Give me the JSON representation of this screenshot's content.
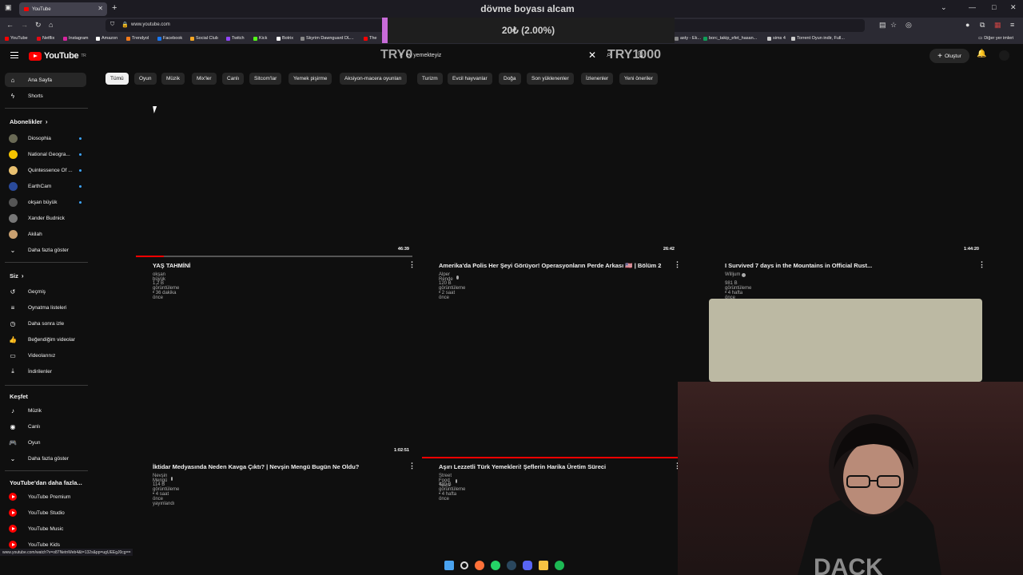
{
  "browser": {
    "tab_title": "YouTube",
    "url": "www.youtube.com",
    "status_url": "www.youtube.com/watch?v=o87NetnWeb4&t=132s&pp=ugUEEgJ0cg==",
    "bookmarks": [
      {
        "label": "YouTube",
        "color": "#ff0000"
      },
      {
        "label": "Netflix",
        "color": "#e50914"
      },
      {
        "label": "Instagram",
        "color": "#d6249f"
      },
      {
        "label": "Amazon",
        "color": "#ffffff"
      },
      {
        "label": "Trendyol",
        "color": "#f27a1a"
      },
      {
        "label": "Facebook",
        "color": "#1877f2"
      },
      {
        "label": "Social Club",
        "color": "#f5a623"
      },
      {
        "label": "Twitch",
        "color": "#9146ff"
      },
      {
        "label": "Kick",
        "color": "#53fc18"
      },
      {
        "label": "Botrix",
        "color": "#ffffff"
      },
      {
        "label": "Skyrim Dawnguard DL...",
        "color": "#888888"
      },
      {
        "label": "The",
        "color": "#ff0000"
      }
    ],
    "bookmarks_right": [
      {
        "label": "asty - Ek...",
        "color": "#888888"
      },
      {
        "label": "borc_takip_efet_hasan...",
        "color": "#0f9d58"
      },
      {
        "label": "sims 4",
        "color": "#cccccc"
      },
      {
        "label": "Torrent Oyun indir, Full...",
        "color": "#cccccc"
      }
    ],
    "other_bookmarks": "Diğer yer imleri"
  },
  "overlay": {
    "title": "dövme boyası alcam",
    "progress_text": "20₺ (2.00%)",
    "progress_fraction": 0.02,
    "left_label": "TRY0",
    "right_label": "TRY1000",
    "bar_color": "#c86bd8"
  },
  "header": {
    "logo_text": "YouTube",
    "logo_suffix": "TR",
    "search_value": "ev yemekteyiz",
    "search_prefix": "e",
    "create_label": "Oluştur"
  },
  "chips": [
    "Tümü",
    "Oyun",
    "Müzik",
    "Mix'ler",
    "Canlı",
    "Sitcom'lar",
    "Yemek pişirme",
    "Aksiyon-macera oyunları",
    "Turizm",
    "Evcil hayvanlar",
    "Doğa",
    "Son yüklenenler",
    "İzlenenler",
    "Yeni öneriler"
  ],
  "sidebar": {
    "main": [
      {
        "label": "Ana Sayfa",
        "icon": "home-icon",
        "glyph": "⌂"
      },
      {
        "label": "Shorts",
        "icon": "shorts-icon",
        "glyph": "ϟ"
      }
    ],
    "subs_heading": "Abonelikler",
    "subs": [
      {
        "label": "Diosophia",
        "color": "#6a6a55",
        "dot": true
      },
      {
        "label": "National Geogra...",
        "color": "#f5c400",
        "dot": true
      },
      {
        "label": "Quintessence Of ...",
        "color": "#e8c070",
        "dot": true
      },
      {
        "label": "EarthCam",
        "color": "#2a4a9a",
        "dot": true
      },
      {
        "label": "okşan büyük",
        "color": "#555555",
        "dot": true
      },
      {
        "label": "Xander Budnick",
        "color": "#777777",
        "dot": false
      },
      {
        "label": "Akilah",
        "color": "#c8a070",
        "dot": false
      }
    ],
    "subs_more": "Daha fazla göster",
    "you_heading": "Siz",
    "you": [
      {
        "label": "Geçmiş",
        "icon": "history-icon",
        "glyph": "↺"
      },
      {
        "label": "Oynatma listeleri",
        "icon": "playlists-icon",
        "glyph": "≡"
      },
      {
        "label": "Daha sonra izle",
        "icon": "watch-later-icon",
        "glyph": "◷"
      },
      {
        "label": "Beğendiğim videolar",
        "icon": "like-icon",
        "glyph": "👍"
      },
      {
        "label": "Videolarınız",
        "icon": "your-videos-icon",
        "glyph": "▭"
      },
      {
        "label": "İndirilenler",
        "icon": "download-icon",
        "glyph": "⤓"
      }
    ],
    "explore_heading": "Keşfet",
    "explore": [
      {
        "label": "Müzik",
        "icon": "music-icon",
        "glyph": "♪"
      },
      {
        "label": "Canlı",
        "icon": "live-icon",
        "glyph": "◉"
      },
      {
        "label": "Oyun",
        "icon": "gaming-icon",
        "glyph": "🎮"
      }
    ],
    "explore_more": "Daha fazla göster",
    "more_heading": "YouTube'dan daha fazla...",
    "more": [
      "YouTube Premium",
      "YouTube Studio",
      "YouTube Music",
      "YouTube Kids"
    ]
  },
  "videos": [
    {
      "title": "YAŞ TAHMİNİ",
      "channel": "okşan büyük",
      "verified": false,
      "meta": "1,2 B görüntüleme • 36 dakika önce",
      "duration": "46:39",
      "watched_fraction": 0.1
    },
    {
      "title": "Amerika'da Polis Her Şeyi Görüyor! Operasyonların Perde Arkası 🇺🇸 | Bölüm 2",
      "channel": "Alper Rende",
      "verified": true,
      "meta": "120 B görüntüleme • 2 saat önce",
      "duration": "26:42",
      "watched_fraction": 0
    },
    {
      "title": "I Survived 7 days in the Mountains in Official Rust...",
      "channel": "Willjum",
      "verified": true,
      "meta": "981 B görüntüleme • 4 hafta önce",
      "duration": "1:44:20",
      "watched_fraction": 0
    },
    {
      "title": "İktidar Medyasında Neden Kavga Çıktı? | Nevşin Mengü Bugün Ne Oldu?",
      "channel": "Nevşin Mengü",
      "verified": true,
      "meta": "114 B görüntüleme • 4 saat önce yayınlandı",
      "duration": "1:02:51",
      "watched_fraction": 0
    },
    {
      "title": "Aşırı Lezzetli Türk Yemekleri! Şeflerin Harika Üretim Süreci",
      "channel": "Street Food Tours",
      "verified": true,
      "meta": "420 B görüntüleme • 4 hafta önce",
      "duration": "",
      "watched_fraction": 1.0
    }
  ]
}
